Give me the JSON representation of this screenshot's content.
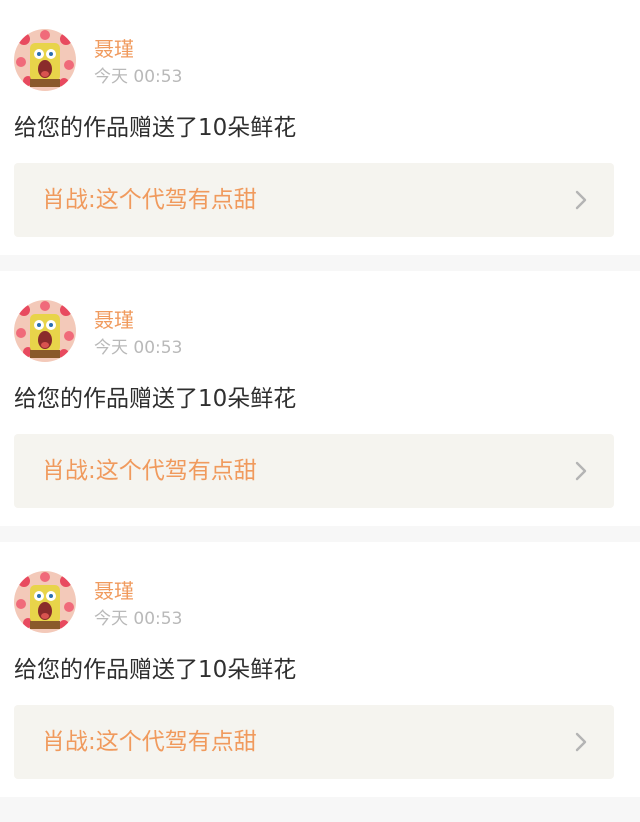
{
  "colors": {
    "accent": "#f09a5d",
    "time": "#b9b9b9",
    "message": "#2f2f2f",
    "link_bg": "#f5f4ef",
    "page_bg": "#f7f7f7"
  },
  "notifications": [
    {
      "user": "聂瑾",
      "avatar_icon": "spongebob-hearts-avatar",
      "time": "今天 00:53",
      "message": "给您的作品赠送了10朵鲜花",
      "work_title": "肖战:这个代驾有点甜",
      "chevron_icon": "chevron-right-icon"
    },
    {
      "user": "聂瑾",
      "avatar_icon": "spongebob-hearts-avatar",
      "time": "今天 00:53",
      "message": "给您的作品赠送了10朵鲜花",
      "work_title": "肖战:这个代驾有点甜",
      "chevron_icon": "chevron-right-icon"
    },
    {
      "user": "聂瑾",
      "avatar_icon": "spongebob-hearts-avatar",
      "time": "今天 00:53",
      "message": "给您的作品赠送了10朵鲜花",
      "work_title": "肖战:这个代驾有点甜",
      "chevron_icon": "chevron-right-icon"
    }
  ]
}
